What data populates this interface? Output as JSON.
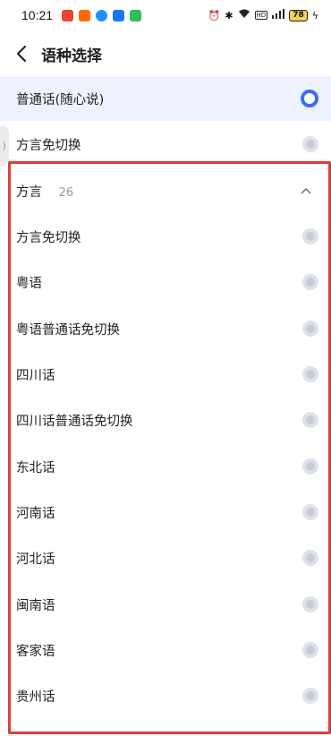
{
  "status": {
    "time": "10:21",
    "battery": "78",
    "app_icons": [
      "weibo-icon",
      "taobao-icon",
      "blue-app-icon",
      "alipay-icon",
      "green-app-icon"
    ],
    "app_colors": [
      "#e9452f",
      "#ff6a00",
      "#1f8fff",
      "#1677ff",
      "#2ebd59"
    ]
  },
  "header": {
    "title": "语种选择"
  },
  "top_options": [
    {
      "label": "普通话(随心说)",
      "selected": true
    },
    {
      "label": "方言免切换",
      "selected": false
    }
  ],
  "group": {
    "title": "方言",
    "count": "26",
    "items": [
      "方言免切换",
      "粤语",
      "粤语普通话免切换",
      "四川话",
      "四川话普通话免切换",
      "东北话",
      "河南话",
      "河北话",
      "闽南语",
      "客家语",
      "贵州话"
    ]
  },
  "colors": {
    "accent": "#3b6cf6",
    "highlight": "#e23a3a",
    "selected_bg": "#eef2fe"
  }
}
